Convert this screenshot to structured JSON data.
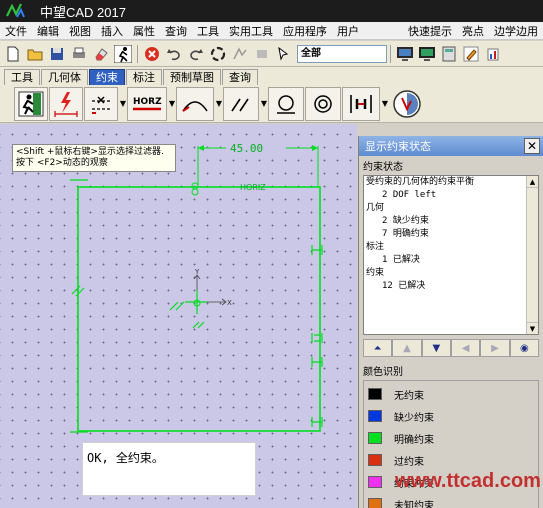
{
  "window": {
    "title": "中望CAD 2017"
  },
  "menu": {
    "left": [
      "文件",
      "编辑",
      "视图",
      "插入",
      "属性",
      "查询",
      "工具",
      "实用工具",
      "应用程序",
      "用户"
    ],
    "right": [
      "快速提示",
      "亮点",
      "边学边用"
    ]
  },
  "toolbar": {
    "layer_value": "全部"
  },
  "tabs": [
    {
      "label": "工具",
      "active": false
    },
    {
      "label": "几何体",
      "active": false
    },
    {
      "label": "约束",
      "active": true
    },
    {
      "label": "标注",
      "active": false
    },
    {
      "label": "预制草图",
      "active": false
    },
    {
      "label": "查询",
      "active": false
    }
  ],
  "constraint_toolbar": {
    "horz_label": "HORZ"
  },
  "canvas": {
    "hint_line1": "<Shift +鼠标右键>显示选择过滤器.",
    "hint_line2": "按下 <F2>动态的观察",
    "dimension_text": "45.00",
    "dim_horiz_label": "HORIZ",
    "ok_message": "OK, 全约束。",
    "axis_x": "X",
    "axis_y": "Y"
  },
  "panel": {
    "title": "显示约束状态",
    "status_group": "约束状态",
    "status_lines": [
      {
        "text": "受约束的几何体的约束平衡",
        "indent": false
      },
      {
        "text": "2 DOF left",
        "indent": true
      },
      {
        "text": "几何",
        "indent": false
      },
      {
        "text": "2 缺少约束",
        "indent": true
      },
      {
        "text": "7 明确约束",
        "indent": true
      },
      {
        "text": "标注",
        "indent": false
      },
      {
        "text": "1 已解决",
        "indent": true
      },
      {
        "text": "约束",
        "indent": false
      },
      {
        "text": "12 已解决",
        "indent": true
      }
    ],
    "color_group": "颜色识别",
    "colors": [
      {
        "label": "无约束",
        "color": "#000000"
      },
      {
        "label": "缺少约束",
        "color": "#0038e0"
      },
      {
        "label": "明确约束",
        "color": "#00e020"
      },
      {
        "label": "过约束",
        "color": "#d83010"
      },
      {
        "label": "约束冲突",
        "color": "#f030f0"
      },
      {
        "label": "未知约束",
        "color": "#e07010"
      }
    ]
  },
  "watermark": "www.ttcad.com"
}
